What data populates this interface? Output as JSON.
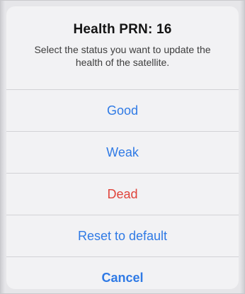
{
  "alert": {
    "title": "Health PRN: 16",
    "message": "Select the status you want to update the health of the satellite.",
    "actions": {
      "good": "Good",
      "weak": "Weak",
      "dead": "Dead",
      "reset": "Reset to default",
      "cancel": "Cancel"
    }
  },
  "colors": {
    "action_blue": "#2f7ae5",
    "destructive_red": "#e0443b"
  }
}
